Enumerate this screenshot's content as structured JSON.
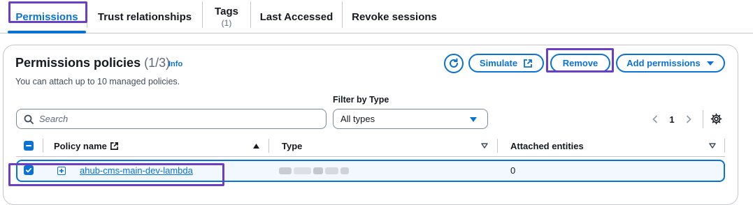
{
  "tabs": [
    {
      "label": "Permissions",
      "sub": ""
    },
    {
      "label": "Trust relationships",
      "sub": ""
    },
    {
      "label": "Tags",
      "sub": "(1)"
    },
    {
      "label": "Last Accessed",
      "sub": ""
    },
    {
      "label": "Revoke sessions",
      "sub": ""
    }
  ],
  "panel": {
    "title": "Permissions policies",
    "count": "(1/3)",
    "info": "Info",
    "description": "You can attach up to 10 managed policies."
  },
  "actions": {
    "simulate": "Simulate",
    "remove": "Remove",
    "add": "Add permissions"
  },
  "filter": {
    "search_placeholder": "Search",
    "type_label": "Filter by Type",
    "type_value": "All types"
  },
  "pagination": {
    "current": "1"
  },
  "table": {
    "columns": [
      "Policy name",
      "Type",
      "Attached entities"
    ],
    "rows": [
      {
        "policy_name": "ahub-cms-main-dev-lambda",
        "type": "",
        "attached_entities": "0"
      }
    ]
  },
  "colors": {
    "accent": "#0972d3",
    "highlight": "#6b3fc4"
  },
  "icons": [
    "refresh-icon",
    "external-link-icon",
    "caret-down-icon",
    "search-icon",
    "chevron-left-icon",
    "chevron-right-icon",
    "gear-icon",
    "sort-up-icon",
    "sort-down-icon",
    "checkbox-checked-icon",
    "checkbox-indeterminate-icon",
    "expand-plus-icon"
  ]
}
